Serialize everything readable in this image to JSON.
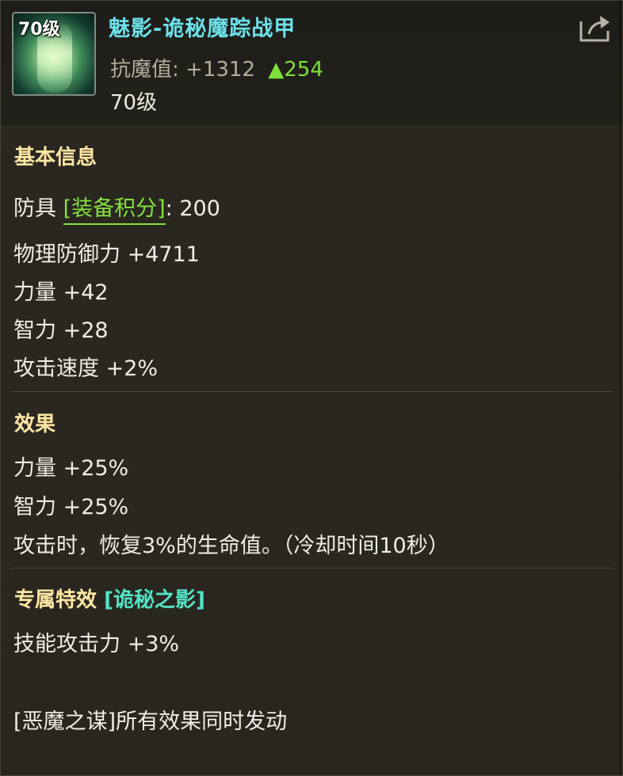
{
  "header": {
    "icon_level": "70级",
    "item_name": "魅影-诡秘魔踪战甲",
    "stat_label": "抗魔值:",
    "stat_value": "+1312",
    "stat_arrow": "▲",
    "stat_delta": "254",
    "level": "70级",
    "share_icon": "share-icon"
  },
  "basic": {
    "title": "基本信息",
    "armor_label": "防具",
    "score_tag": "[装备积分]",
    "score_colon": ":",
    "score_value": "200",
    "lines": [
      "物理防御力 +4711",
      "力量 +42",
      "智力 +28",
      "攻击速度 +2%"
    ]
  },
  "effect": {
    "title": "效果",
    "lines": [
      "力量 +25%",
      "智力 +25%",
      "攻击时，恢复3%的生命值。（冷却时间10秒）"
    ]
  },
  "special": {
    "title": "专属特效",
    "name": "[诡秘之影]",
    "lines": [
      "技能攻击力 +3%"
    ]
  },
  "set_note": "[恶魔之谋]所有效果同时发动",
  "colors": {
    "item_name": "#6ce0e8",
    "section_title": "#ffe7a3",
    "positive": "#7de03a",
    "special_name": "#53e3c4",
    "text": "#f0ede6"
  }
}
